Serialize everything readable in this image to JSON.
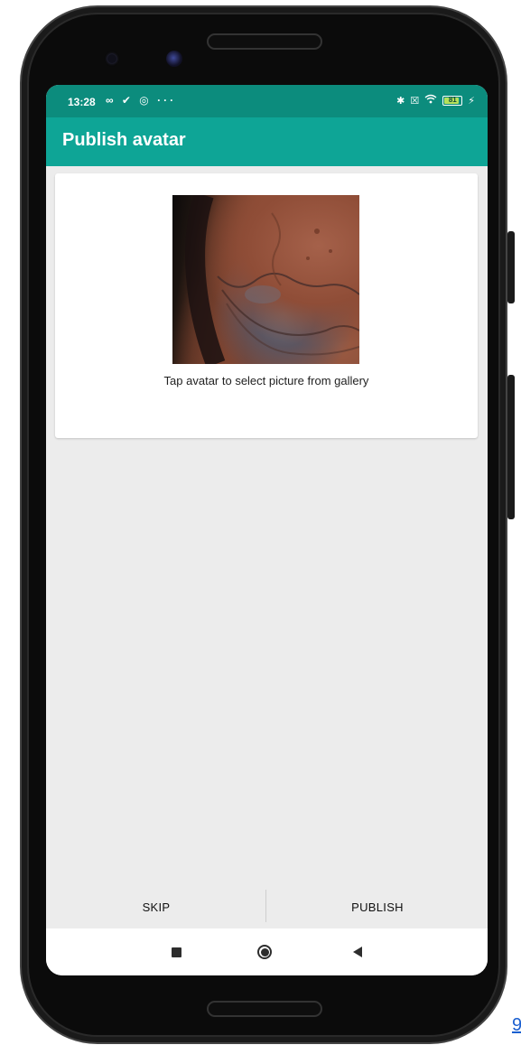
{
  "status_bar": {
    "time": "13:28",
    "left_icons": "∞ ✔ ◎ ···",
    "battery_level": "81",
    "icons": [
      "bluetooth-icon",
      "sim-icon",
      "wifi-icon",
      "battery-icon",
      "charging-icon"
    ]
  },
  "app_bar": {
    "title": "Publish avatar"
  },
  "avatar": {
    "caption": "Tap avatar to select picture from gallery"
  },
  "actions": {
    "skip_label": "SKIP",
    "publish_label": "PUBLISH"
  },
  "nav_bar": {
    "icons": [
      "recents-icon",
      "home-icon",
      "back-icon"
    ]
  },
  "corner_text": "9",
  "colors": {
    "status_bar": "#0c8c7d",
    "app_bar": "#0ea596",
    "background": "#ececec",
    "card": "#ffffff"
  }
}
